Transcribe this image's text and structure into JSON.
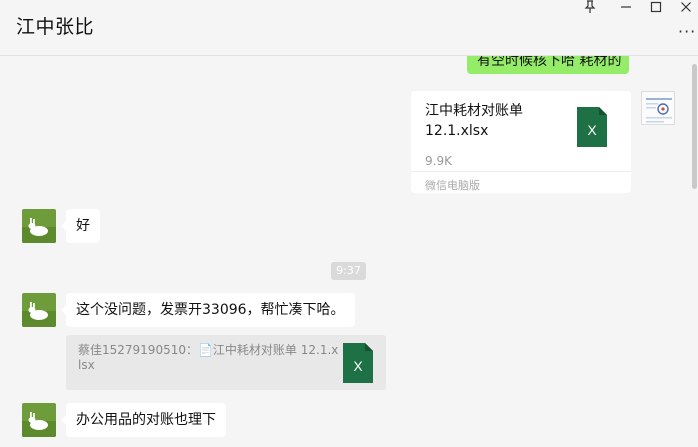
{
  "window": {
    "title": "江中张比",
    "controls": {
      "pin_icon": "pin-icon",
      "minimize_icon": "minimize-icon",
      "maximize_icon": "maximize-icon",
      "close_icon": "close-icon",
      "more_icon": "more-icon"
    }
  },
  "messages": {
    "top_partial": {
      "text": "有空时候核下哈 耗材的"
    },
    "file": {
      "name": "江中耗材对账单12.1.xlsx",
      "size": "9.9K",
      "source": "微信电脑版",
      "icon_letter": "X"
    },
    "reply_ok": {
      "text": "好"
    },
    "time": "9:37",
    "reply_invoice": {
      "text": "这个没问题，发票开33096，帮忙凑下哈。"
    },
    "quote": {
      "text": "蔡佳15279190510：📄江中耗材对账单 12.1.xlsx",
      "icon_letter": "X"
    },
    "reply_office": {
      "text": "办公用品的对账也理下"
    }
  },
  "colors": {
    "self_bubble": "#95ec69",
    "other_bubble": "#ffffff",
    "background": "#f5f5f5",
    "excel_green": "#1e7145"
  }
}
